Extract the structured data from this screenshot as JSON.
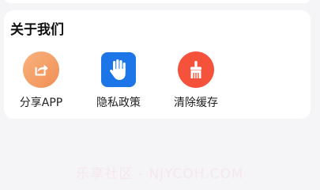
{
  "about_section": {
    "title": "关于我们",
    "items": [
      {
        "label": "分享APP",
        "icon": "share-icon",
        "color": "#f39a63"
      },
      {
        "label": "隐私政策",
        "icon": "hand-stop-icon",
        "color": "#1d76e8"
      },
      {
        "label": "清除缓存",
        "icon": "broom-icon",
        "color": "#f4523b"
      }
    ]
  },
  "watermark": "乐享社区 - NJYCOH.COM"
}
